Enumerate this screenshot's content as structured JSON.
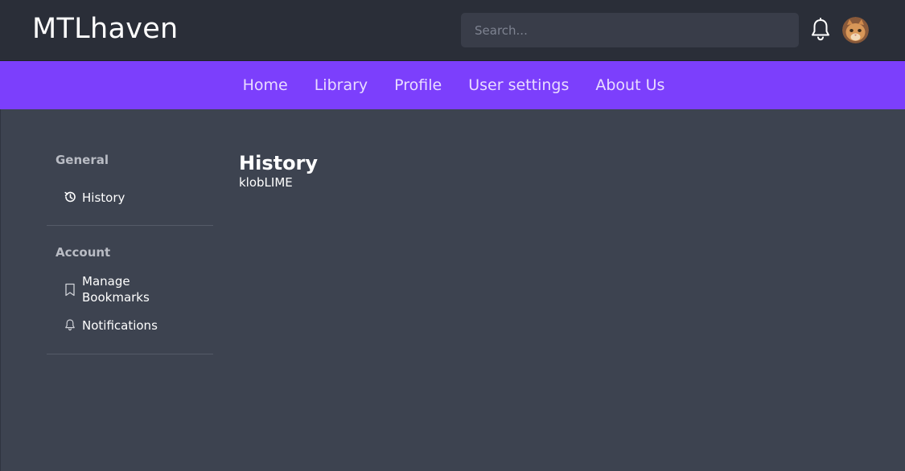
{
  "app": {
    "brand": "MTLhaven",
    "icons": {
      "notifications": "bell-icon",
      "avatar": "cat-avatar"
    }
  },
  "search": {
    "placeholder": "Search...",
    "value": ""
  },
  "nav": {
    "items": [
      {
        "label": "Home"
      },
      {
        "label": "Library"
      },
      {
        "label": "Profile"
      },
      {
        "label": "User settings"
      },
      {
        "label": "About Us"
      }
    ]
  },
  "sidebar": {
    "sections": [
      {
        "title": "General",
        "items": [
          {
            "label": "History",
            "icon": "history-icon"
          }
        ]
      },
      {
        "title": "Account",
        "items": [
          {
            "label": "Manage Bookmarks",
            "icon": "bookmark-icon"
          },
          {
            "label": "Notifications",
            "icon": "bell-icon"
          }
        ]
      }
    ]
  },
  "content": {
    "title": "History",
    "subtitle": "klobLIME"
  },
  "colors": {
    "topbar": "#2a2e38",
    "navbar": "#7c3ffc",
    "background": "#3d4350",
    "search_bg": "#393d49"
  }
}
